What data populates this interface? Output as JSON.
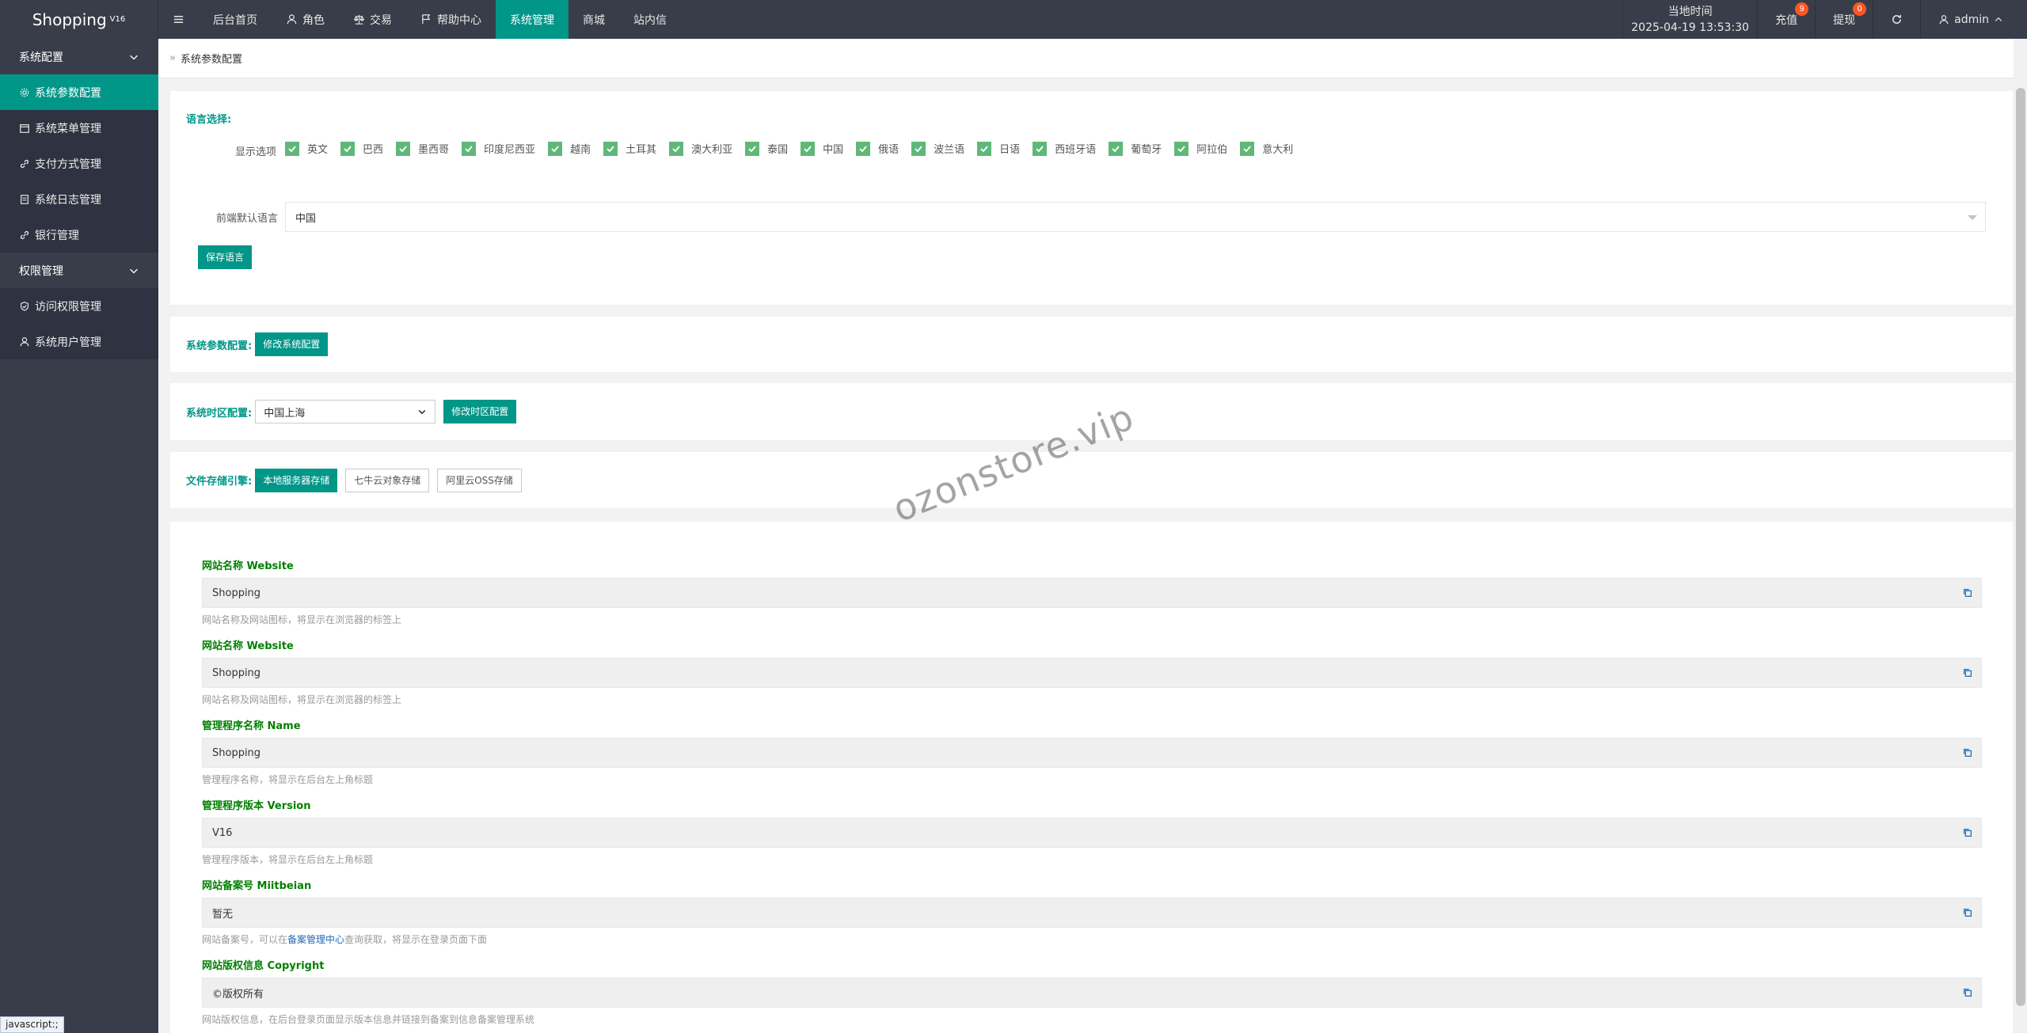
{
  "app": {
    "logo": "Shopping",
    "logo_version": "V16"
  },
  "nav": [
    {
      "label": "后台首页",
      "icon": ""
    },
    {
      "label": "角色",
      "icon": "user-icon"
    },
    {
      "label": "交易",
      "icon": "scale-icon"
    },
    {
      "label": "帮助中心",
      "icon": "flag-icon"
    },
    {
      "label": "系统管理",
      "icon": "",
      "active": true
    },
    {
      "label": "商城",
      "icon": ""
    },
    {
      "label": "站内信",
      "icon": ""
    }
  ],
  "header": {
    "time_label": "当地时间",
    "time_value": "2025-04-19 13:53:30",
    "recharge": "充值",
    "recharge_badge": "9",
    "withdraw": "提现",
    "withdraw_badge": "0",
    "user": "admin"
  },
  "sidebar": {
    "group1": "系统配置",
    "items1": [
      "系统参数配置",
      "系统菜单管理",
      "支付方式管理",
      "系统日志管理",
      "银行管理"
    ],
    "group2": "权限管理",
    "items2": [
      "访问权限管理",
      "系统用户管理"
    ]
  },
  "breadcrumb": {
    "sep": "»",
    "title": "系统参数配置"
  },
  "language": {
    "title": "语言选择:",
    "show_label": "显示选项",
    "options": [
      "英文",
      "巴西",
      "墨西哥",
      "印度尼西亚",
      "越南",
      "土耳其",
      "澳大利亚",
      "泰国",
      "中国",
      "俄语",
      "波兰语",
      "日语",
      "西班牙语",
      "葡萄牙",
      "阿拉伯",
      "意大利"
    ],
    "default_label": "前端默认语言",
    "default_value": "中国",
    "save_button": "保存语言"
  },
  "sys_param": {
    "title": "系统参数配置:",
    "button": "修改系统配置"
  },
  "timezone": {
    "title": "系统时区配置:",
    "value": "中国上海",
    "button": "修改时区配置"
  },
  "storage": {
    "title": "文件存储引擎:",
    "options": [
      "本地服务器存储",
      "七牛云对象存储",
      "阿里云OSS存储"
    ]
  },
  "fields": [
    {
      "label": "网站名称 Website",
      "value": "Shopping",
      "help": "网站名称及网站图标，将显示在浏览器的标签上"
    },
    {
      "label": "网站名称 Website",
      "value": "Shopping",
      "help": "网站名称及网站图标，将显示在浏览器的标签上"
    },
    {
      "label": "管理程序名称 Name",
      "value": "Shopping",
      "help": "管理程序名称，将显示在后台左上角标题"
    },
    {
      "label": "管理程序版本 Version",
      "value": "V16",
      "help": "管理程序版本，将显示在后台左上角标题"
    },
    {
      "label": "网站备案号 Miitbeian",
      "value": "暂无",
      "help_pre": "网站备案号，可以在",
      "help_link": "备案管理中心",
      "help_post": "查询获取，将显示在登录页面下面"
    },
    {
      "label": "网站版权信息 Copyright",
      "value": "©版权所有",
      "help": "网站版权信息，在后台登录页面显示版本信息并链接到备案到信息备案管理系统"
    }
  ],
  "watermark": "ozonstore.vip",
  "status_bar": "javascript:;",
  "colors": {
    "accent": "#009688",
    "header_bg": "#393d49",
    "check": "#5fb878",
    "badge": "#ff5722",
    "field_label": "#008000"
  }
}
